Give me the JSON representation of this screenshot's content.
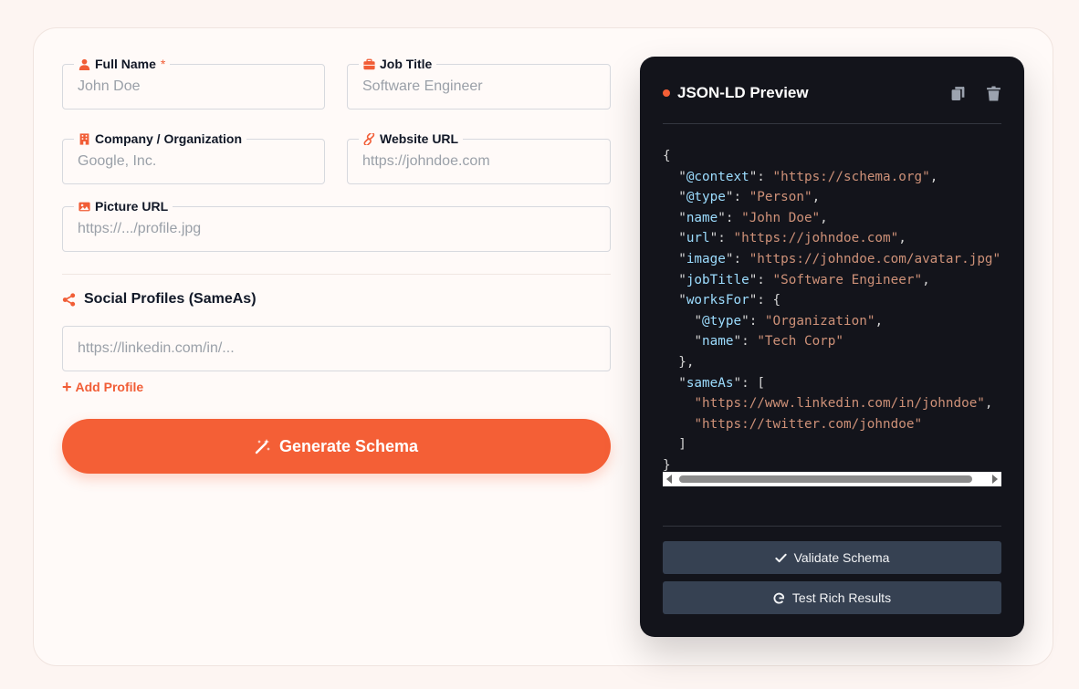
{
  "form": {
    "full_name": {
      "label": "Full Name",
      "required_mark": "*",
      "placeholder": "John Doe",
      "icon": "user-icon"
    },
    "job_title": {
      "label": "Job Title",
      "placeholder": "Software Engineer",
      "icon": "briefcase-icon"
    },
    "company": {
      "label": "Company / Organization",
      "placeholder": "Google, Inc.",
      "icon": "building-icon"
    },
    "website": {
      "label": "Website URL",
      "placeholder": "https://johndoe.com",
      "icon": "link-icon"
    },
    "picture": {
      "label": "Picture URL",
      "placeholder": "https://.../profile.jpg",
      "icon": "image-icon"
    }
  },
  "social": {
    "heading": "Social Profiles (SameAs)",
    "icon": "share-icon",
    "placeholder": "https://linkedin.com/in/...",
    "add_label": "Add Profile"
  },
  "generate_button": {
    "label": "Generate Schema",
    "icon": "magic-wand-icon"
  },
  "preview": {
    "title": "JSON-LD Preview",
    "icons": [
      "copy-icon",
      "trash-icon"
    ],
    "json": {
      "@context": "https://schema.org",
      "@type": "Person",
      "name": "John Doe",
      "url": "https://johndoe.com",
      "image": "https://johndoe.com/avatar.jpg",
      "jobTitle": "Software Engineer",
      "worksFor": {
        "@type": "Organization",
        "name": "Tech Corp"
      },
      "sameAs": [
        "https://www.linkedin.com/in/johndoe",
        "https://twitter.com/johndoe"
      ]
    },
    "validate_label": "Validate Schema",
    "test_label": "Test Rich Results"
  },
  "colors": {
    "accent": "#f45f36",
    "panel_bg": "#13141b",
    "key": "#9cdcfe",
    "string": "#ce9178",
    "secondary_button": "#364152"
  }
}
